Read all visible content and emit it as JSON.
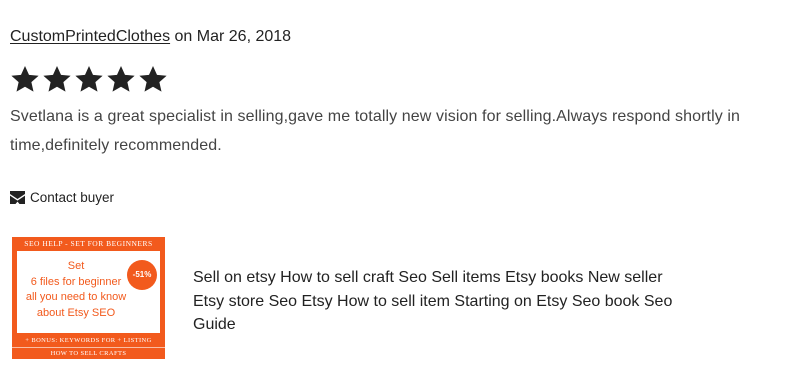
{
  "review": {
    "reviewer_name": "CustomPrintedClothes",
    "date_text": " on Mar 26, 2018",
    "rating": 5,
    "stars": [
      "star",
      "star",
      "star",
      "star",
      "star"
    ],
    "body": "Svetlana is a great specialist in selling,gave me totally new vision for selling.Always respond shortly in time,definitely recommended.",
    "star_color": "#222222"
  },
  "contact": {
    "icon": "envelope-icon",
    "label": "Contact buyer"
  },
  "listing": {
    "thumbnail": {
      "top_banner": "SEO HELP - SET FOR BEGINNERS",
      "panel_line1": "Set",
      "panel_line2": "6 files for beginner",
      "panel_line3": "all you need to know",
      "panel_line4": "about Etsy SEO",
      "badge": "-51%",
      "bottom_line1": "+ BONUS: KEYWORDS FOR + LISTING",
      "bottom_line2": "HOW TO SELL CRAFTS",
      "accent_color": "#f25a1d"
    },
    "title": "Sell on etsy How to sell craft Seo Sell items Etsy books New seller Etsy store Seo Etsy How to sell item Starting on Etsy Seo book Seo Guide"
  }
}
